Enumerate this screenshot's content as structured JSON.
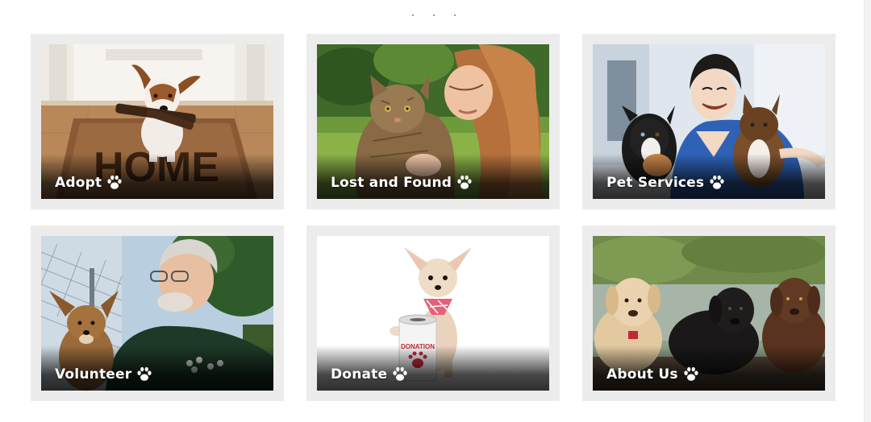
{
  "tiles": [
    {
      "label": "Adopt",
      "icon": "paw-icon"
    },
    {
      "label": "Lost and Found",
      "icon": "paw-icon"
    },
    {
      "label": "Pet Services",
      "icon": "paw-icon"
    },
    {
      "label": "Volunteer",
      "icon": "paw-icon"
    },
    {
      "label": "Donate",
      "icon": "paw-icon"
    },
    {
      "label": "About Us",
      "icon": "paw-icon"
    }
  ],
  "donation_can_text": "DONATION",
  "doormat_text": "HOME",
  "colors": {
    "card_frame": "#ececec",
    "caption_text": "#ffffff",
    "page_background": "#ffffff"
  }
}
